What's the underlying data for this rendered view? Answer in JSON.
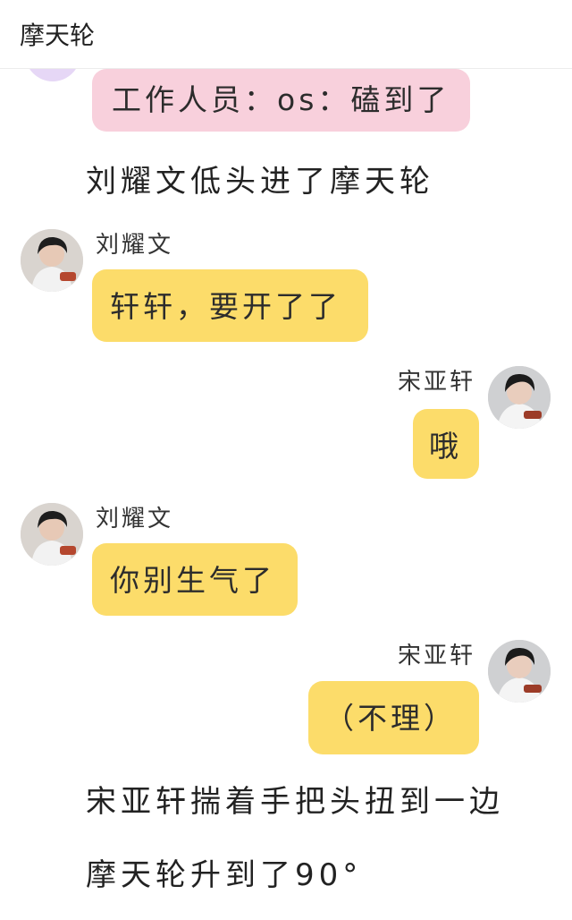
{
  "header": {
    "title": "摩天轮"
  },
  "messages": {
    "staff": {
      "text": "工作人员：os：磕到了"
    },
    "narr1": "刘耀文低头进了摩天轮",
    "m1": {
      "name": "刘耀文",
      "text": "轩轩，要开了了"
    },
    "m2": {
      "name": "宋亚轩",
      "text": "哦"
    },
    "m3": {
      "name": "刘耀文",
      "text": "你别生气了"
    },
    "m4": {
      "name": "宋亚轩",
      "text": "（不理）"
    },
    "narr2": "宋亚轩揣着手把头扭到一边",
    "narr3": "摩天轮升到了90°"
  },
  "colors": {
    "pink_bubble": "#f8d0dc",
    "yellow_bubble": "#fcdc6a",
    "avatar_partial": "#e6d7f6"
  },
  "icons": {
    "avatar_left": "avatar-liu-yaowen-icon",
    "avatar_right": "avatar-song-yaxuan-icon"
  }
}
